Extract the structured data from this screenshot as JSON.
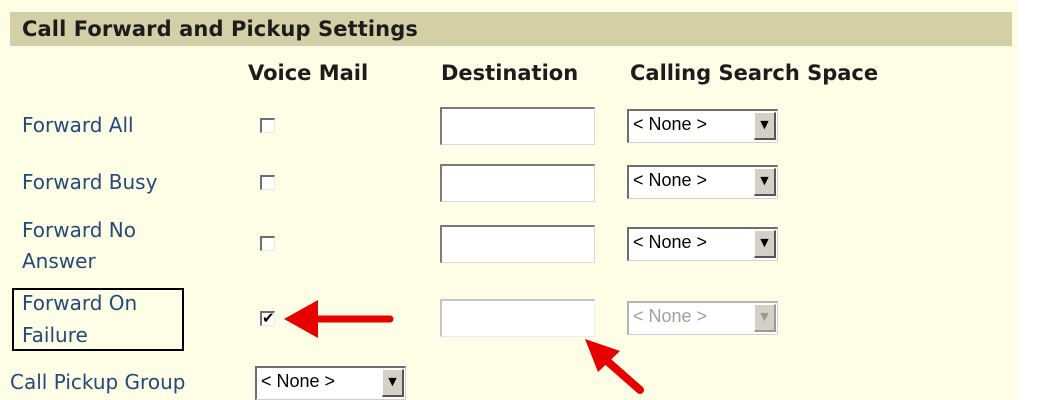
{
  "section": {
    "title": "Call Forward and Pickup Settings"
  },
  "columns": {
    "voice_mail": "Voice Mail",
    "destination": "Destination",
    "calling_search_space": "Calling Search Space"
  },
  "rows": [
    {
      "label": "Forward All",
      "voice_mail_checked": false,
      "destination_value": "",
      "css_selected": "< None >",
      "disabled": false
    },
    {
      "label": "Forward Busy",
      "voice_mail_checked": false,
      "destination_value": "",
      "css_selected": "< None >",
      "disabled": false
    },
    {
      "label_line1": "Forward No",
      "label_line2": "Answer",
      "voice_mail_checked": false,
      "destination_value": "",
      "css_selected": "< None >",
      "disabled": false
    },
    {
      "label_line1": "Forward On",
      "label_line2": "Failure",
      "voice_mail_checked": true,
      "destination_value": "",
      "css_selected": "< None >",
      "disabled": true
    }
  ],
  "pickup": {
    "label": "Call Pickup Group",
    "selected": "< None >"
  },
  "checkbox_mark": "✔",
  "dropdown_arrow": "▼",
  "colors": {
    "panel_background": "#fefde6",
    "header_background": "#d3cfa6",
    "label_text": "#244a7a",
    "annotation_arrow": "#e60000"
  }
}
